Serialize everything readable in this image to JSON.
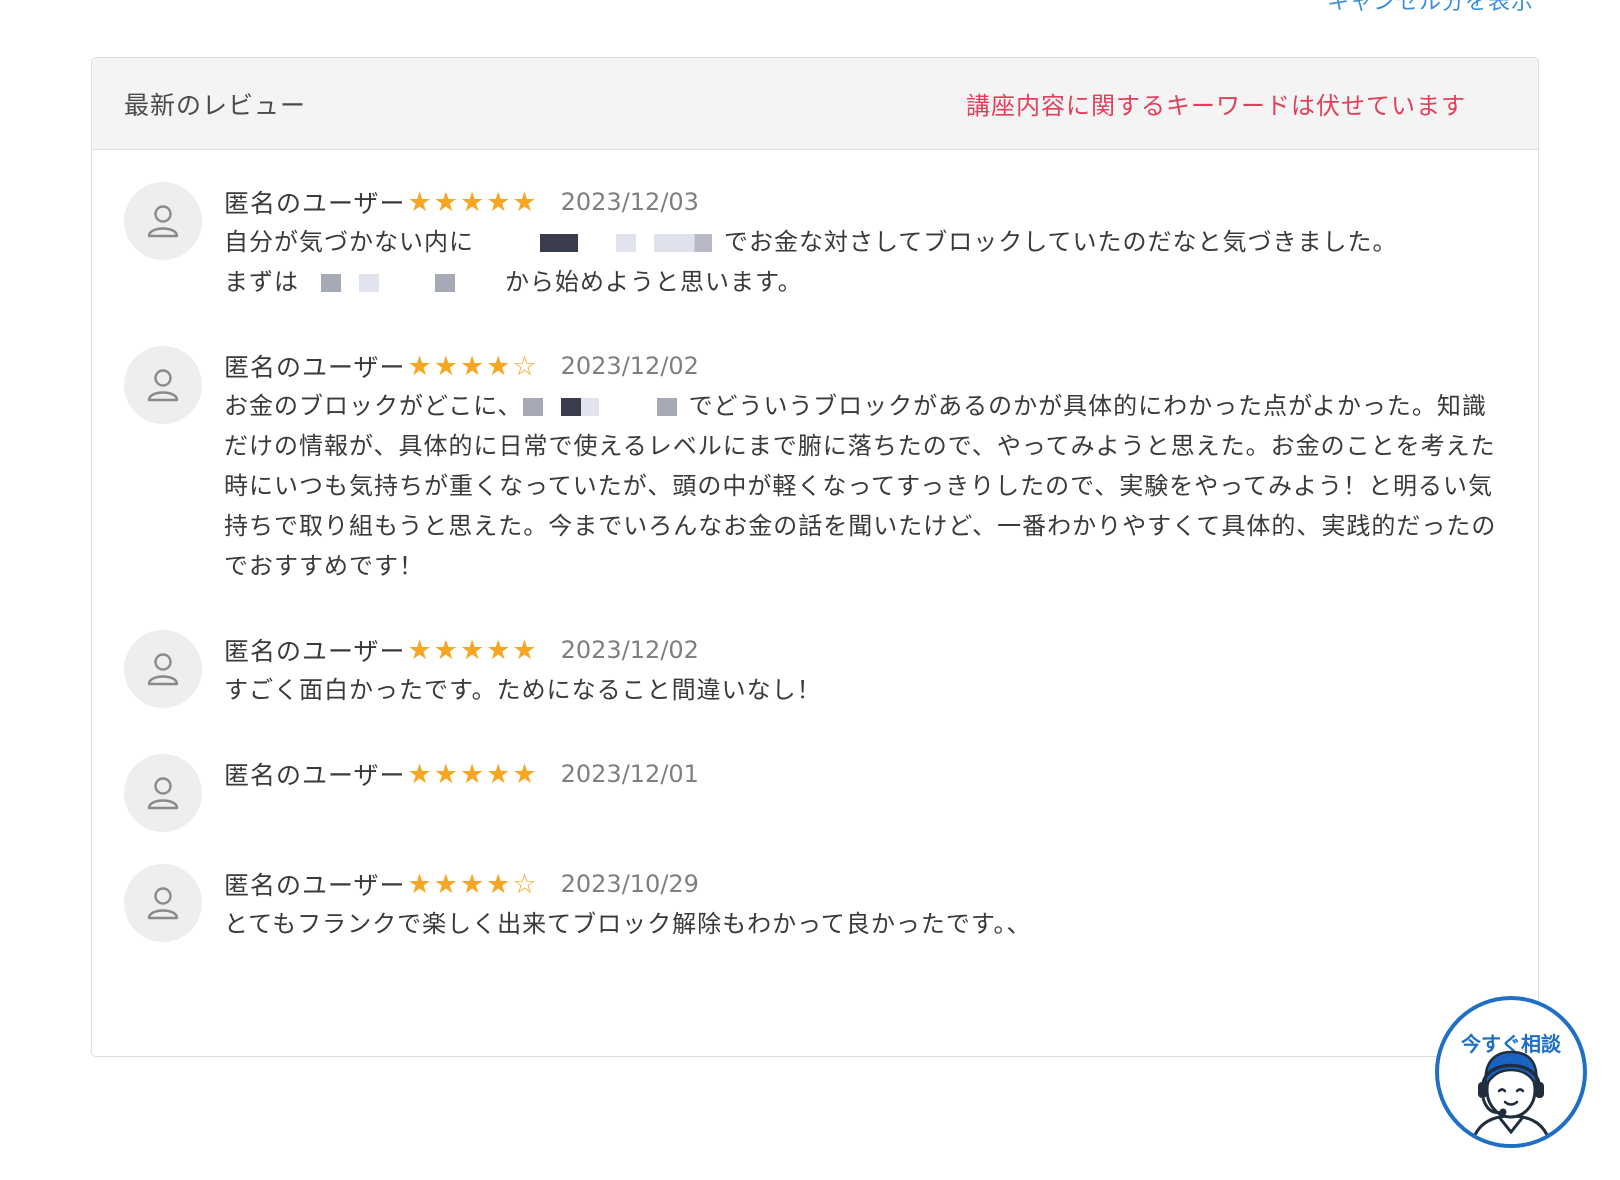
{
  "top_link": "キャンセル分を表示",
  "header": {
    "title": "最新のレビュー",
    "notice": "講座内容に関するキーワードは伏せています"
  },
  "colors": {
    "accent_blue": "#1f6fc6",
    "notice_red": "#e2405a",
    "star": "#f5a623"
  },
  "reviews": [
    {
      "user": "匿名のユーザー",
      "rating": 5,
      "date": "2023/12/03",
      "text_1": "自分が気づかない内に",
      "text_2": "でお金な対さしてブロックしていたのだなと気づきました。",
      "text_3": "まずは",
      "text_4": "から始めようと思います。"
    },
    {
      "user": "匿名のユーザー",
      "rating": 4,
      "date": "2023/12/02",
      "text_1": "お金のブロックがどこに、",
      "text_2": "でどういうブロックがあるのかが具体的にわかった点がよかった。知識だけの情報が、具体的に日常で使えるレベルにまで腑に落ちたので、やってみようと思えた。お金のことを考えた時にいつも気持ちが重くなっていたが、頭の中が軽くなってすっきりしたので、実験をやってみよう！と明るい気持ちで取り組もうと思えた。今までいろんなお金の話を聞いたけど、一番わかりやすくて具体的、実践的だったのでおすすめです！"
    },
    {
      "user": "匿名のユーザー",
      "rating": 5,
      "date": "2023/12/02",
      "text": "すごく面白かったです。ためになること間違いなし！"
    },
    {
      "user": "匿名のユーザー",
      "rating": 5,
      "date": "2023/12/01",
      "text": ""
    },
    {
      "user": "匿名のユーザー",
      "rating": 4,
      "date": "2023/10/29",
      "text": "とてもフランクで楽しく出来てブロック解除もわかって良かったです。、"
    }
  ],
  "chat_button": {
    "label": "今すぐ相談",
    "icon": "support-operator-icon"
  }
}
